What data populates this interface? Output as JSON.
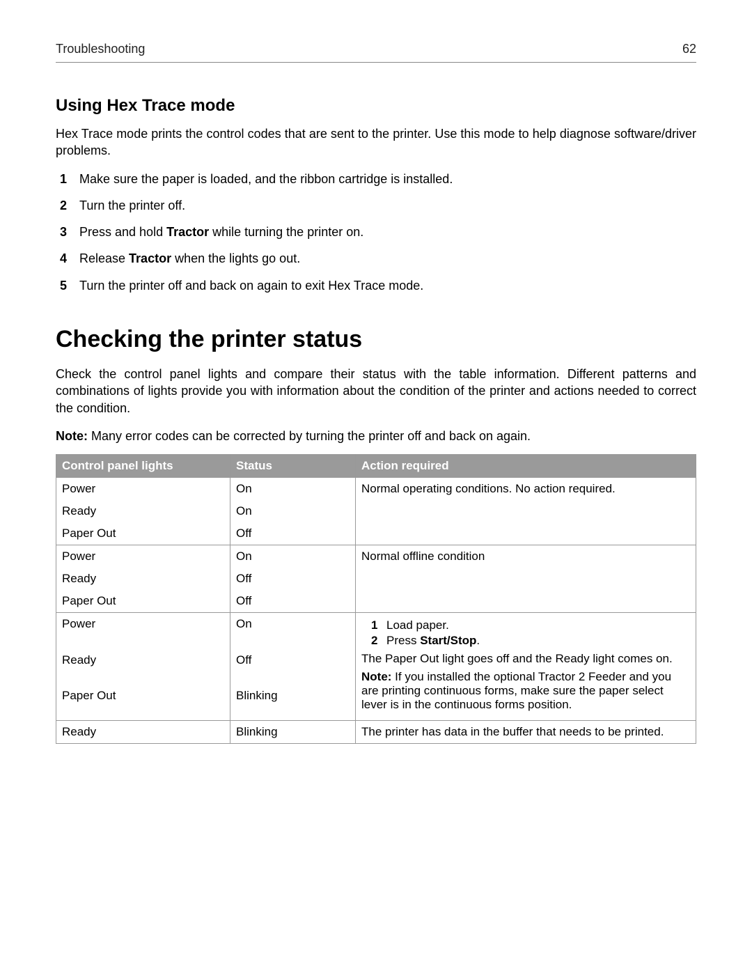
{
  "header": {
    "section": "Troubleshooting",
    "page_number": "62"
  },
  "hex": {
    "heading": "Using Hex Trace mode",
    "intro": "Hex Trace mode prints the control codes that are sent to the printer. Use this mode to help diagnose software/driver problems.",
    "steps": {
      "s1": "Make sure the paper is loaded, and the ribbon cartridge is installed.",
      "s2": "Turn the printer off.",
      "s3_pre": "Press and hold ",
      "s3_bold": "Tractor",
      "s3_post": " while turning the printer on.",
      "s4_pre": "Release ",
      "s4_bold": "Tractor",
      "s4_post": " when the lights go out.",
      "s5": "Turn the printer off and back on again to exit Hex Trace mode."
    }
  },
  "status": {
    "heading": "Checking the printer status",
    "intro": "Check the control panel lights and compare their status with the table information. Different patterns and combinations of lights provide you with information about the condition of the printer and actions needed to correct the condition.",
    "note_label": "Note:",
    "note_text": " Many error codes can be corrected by turning the printer off and back on again.",
    "columns": {
      "lights": "Control panel lights",
      "status": "Status",
      "action": "Action required"
    },
    "rows": {
      "g1": {
        "l1": "Power",
        "s1": "On",
        "l2": "Ready",
        "s2": "On",
        "l3": "Paper Out",
        "s3": "Off",
        "action": "Normal operating conditions. No action required."
      },
      "g2": {
        "l1": "Power",
        "s1": "On",
        "l2": "Ready",
        "s2": "Off",
        "l3": "Paper Out",
        "s3": "Off",
        "action": "Normal offline condition"
      },
      "g3": {
        "l1": "Power",
        "s1": "On",
        "l2": "Ready",
        "s2": "Off",
        "l3": "Paper Out",
        "s3": "Blinking",
        "step1": "Load paper.",
        "step2_pre": "Press ",
        "step2_bold": "Start/Stop",
        "step2_post": ".",
        "after": "The Paper Out light goes off and the Ready light comes on.",
        "note_label": "Note:",
        "note_text": " If you installed the optional Tractor 2 Feeder and you are printing continuous forms, make sure the paper select lever is in the continuous forms position."
      },
      "g4": {
        "l1": "Ready",
        "s1": "Blinking",
        "action": "The printer has data in the buffer that needs to be printed."
      }
    }
  }
}
